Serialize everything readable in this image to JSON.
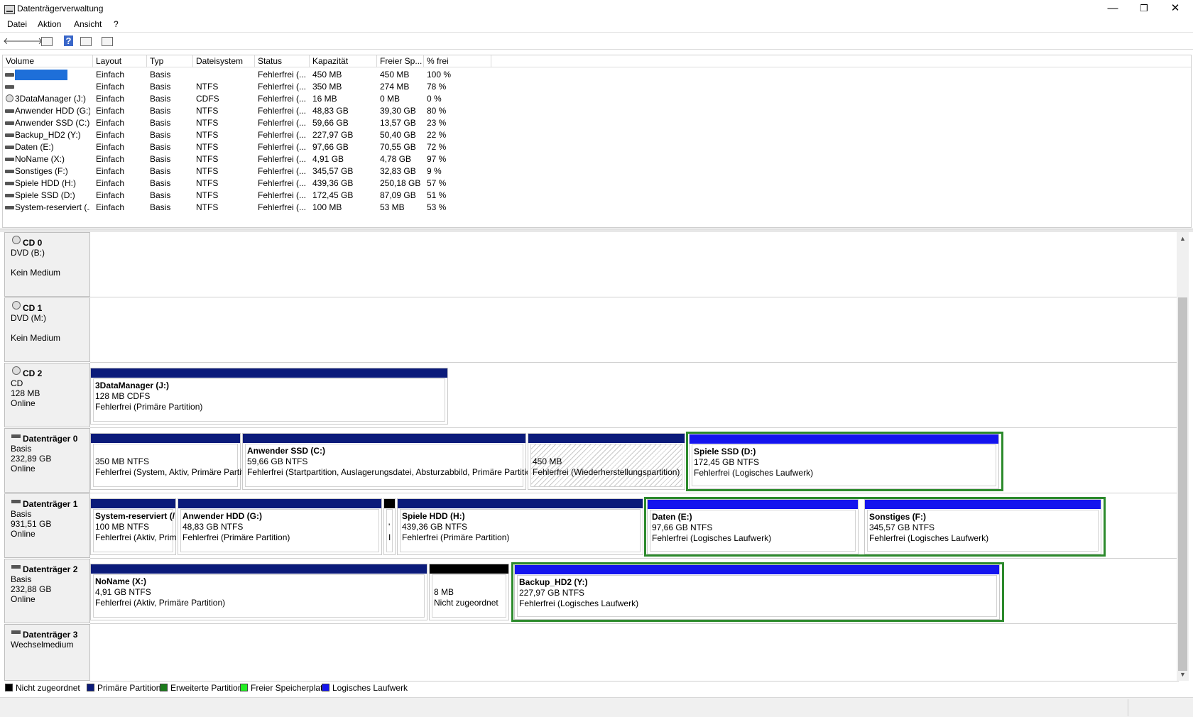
{
  "window": {
    "title": "Datenträgerverwaltung",
    "min": "—",
    "restore": "❐",
    "close": "✕"
  },
  "menu": [
    "Datei",
    "Aktion",
    "Ansicht",
    "?"
  ],
  "toolbar": {
    "back": "🡐",
    "forward": "🡒",
    "help": "?"
  },
  "volume_table": {
    "headers": [
      "Volume",
      "Layout",
      "Typ",
      "Dateisystem",
      "Status",
      "Kapazität",
      "Freier Sp...",
      "% frei"
    ],
    "rows": [
      {
        "volume": "",
        "layout": "Einfach",
        "typ": "Basis",
        "fs": "",
        "status": "Fehlerfrei (...",
        "cap": "450 MB",
        "free": "450 MB",
        "pct": "100 %",
        "icon": "drive-icon",
        "selected": true
      },
      {
        "volume": "",
        "layout": "Einfach",
        "typ": "Basis",
        "fs": "NTFS",
        "status": "Fehlerfrei (...",
        "cap": "350 MB",
        "free": "274 MB",
        "pct": "78 %",
        "icon": "drive-icon"
      },
      {
        "volume": "3DataManager (J:)",
        "layout": "Einfach",
        "typ": "Basis",
        "fs": "CDFS",
        "status": "Fehlerfrei (...",
        "cap": "16 MB",
        "free": "0 MB",
        "pct": "0 %",
        "icon": "cd-icon"
      },
      {
        "volume": "Anwender HDD (G:)",
        "layout": "Einfach",
        "typ": "Basis",
        "fs": "NTFS",
        "status": "Fehlerfrei (...",
        "cap": "48,83 GB",
        "free": "39,30 GB",
        "pct": "80 %",
        "icon": "drive-icon"
      },
      {
        "volume": "Anwender SSD (C:)",
        "layout": "Einfach",
        "typ": "Basis",
        "fs": "NTFS",
        "status": "Fehlerfrei (...",
        "cap": "59,66 GB",
        "free": "13,57 GB",
        "pct": "23 %",
        "icon": "drive-icon"
      },
      {
        "volume": "Backup_HD2 (Y:)",
        "layout": "Einfach",
        "typ": "Basis",
        "fs": "NTFS",
        "status": "Fehlerfrei (...",
        "cap": "227,97 GB",
        "free": "50,40 GB",
        "pct": "22 %",
        "icon": "drive-icon"
      },
      {
        "volume": "Daten (E:)",
        "layout": "Einfach",
        "typ": "Basis",
        "fs": "NTFS",
        "status": "Fehlerfrei (...",
        "cap": "97,66 GB",
        "free": "70,55 GB",
        "pct": "72 %",
        "icon": "drive-icon"
      },
      {
        "volume": "NoName (X:)",
        "layout": "Einfach",
        "typ": "Basis",
        "fs": "NTFS",
        "status": "Fehlerfrei (...",
        "cap": "4,91 GB",
        "free": "4,78 GB",
        "pct": "97 %",
        "icon": "drive-icon"
      },
      {
        "volume": "Sonstiges (F:)",
        "layout": "Einfach",
        "typ": "Basis",
        "fs": "NTFS",
        "status": "Fehlerfrei (...",
        "cap": "345,57 GB",
        "free": "32,83 GB",
        "pct": "9 %",
        "icon": "drive-icon"
      },
      {
        "volume": "Spiele HDD (H:)",
        "layout": "Einfach",
        "typ": "Basis",
        "fs": "NTFS",
        "status": "Fehlerfrei (...",
        "cap": "439,36 GB",
        "free": "250,18 GB",
        "pct": "57 %",
        "icon": "drive-icon"
      },
      {
        "volume": "Spiele SSD (D:)",
        "layout": "Einfach",
        "typ": "Basis",
        "fs": "NTFS",
        "status": "Fehlerfrei (...",
        "cap": "172,45 GB",
        "free": "87,09 GB",
        "pct": "51 %",
        "icon": "drive-icon"
      },
      {
        "volume": "System-reserviert (...",
        "layout": "Einfach",
        "typ": "Basis",
        "fs": "NTFS",
        "status": "Fehlerfrei (...",
        "cap": "100 MB",
        "free": "53 MB",
        "pct": "53 %",
        "icon": "drive-icon"
      }
    ]
  },
  "disks": [
    {
      "name": "CD 0",
      "lines": [
        "DVD (B:)",
        "",
        "Kein Medium"
      ],
      "icon": "cd-icon",
      "partitions": []
    },
    {
      "name": "CD 1",
      "lines": [
        "DVD (M:)",
        "",
        "Kein Medium"
      ],
      "icon": "cd-icon",
      "partitions": []
    },
    {
      "name": "CD 2",
      "lines": [
        "CD",
        "128 MB",
        "Online"
      ],
      "icon": "cd-icon",
      "partitions": [
        {
          "title": "3DataManager  (J:)",
          "size": "128 MB CDFS",
          "status": "Fehlerfrei (Primäre Partition)",
          "kind": "primary"
        }
      ]
    },
    {
      "name": "Datenträger 0",
      "lines": [
        "Basis",
        "232,89 GB",
        "Online"
      ],
      "icon": "drive-icon",
      "partitions": [
        {
          "title": "",
          "size": "350 MB NTFS",
          "status": "Fehlerfrei (System, Aktiv, Primäre Partitio",
          "kind": "primary"
        },
        {
          "title": "Anwender SSD  (C:)",
          "size": "59,66 GB NTFS",
          "status": "Fehlerfrei (Startpartition, Auslagerungsdatei, Absturzabbild, Primäre Partition)",
          "kind": "primary"
        },
        {
          "title": "",
          "size": "450 MB",
          "status": "Fehlerfrei (Wiederherstellungspartition)",
          "kind": "primary-hatched"
        },
        {
          "title": "Spiele SSD  (D:)",
          "size": "172,45 GB NTFS",
          "status": "Fehlerfrei (Logisches Laufwerk)",
          "kind": "logical"
        }
      ]
    },
    {
      "name": "Datenträger 1",
      "lines": [
        "Basis",
        "931,51 GB",
        "Online"
      ],
      "icon": "drive-icon",
      "partitions": [
        {
          "title": "System-reserviert  (/",
          "size": "100 MB NTFS",
          "status": "Fehlerfrei (Aktiv, Prim",
          "kind": "primary"
        },
        {
          "title": "Anwender HDD  (G:)",
          "size": "48,83 GB NTFS",
          "status": "Fehlerfrei (Primäre Partition)",
          "kind": "primary"
        },
        {
          "title": "",
          "size": "'",
          "status": "I",
          "kind": "unallocated"
        },
        {
          "title": "Spiele HDD  (H:)",
          "size": "439,36 GB NTFS",
          "status": "Fehlerfrei (Primäre Partition)",
          "kind": "primary"
        },
        {
          "title": "Daten  (E:)",
          "size": "97,66 GB NTFS",
          "status": "Fehlerfrei (Logisches Laufwerk)",
          "kind": "logical"
        },
        {
          "title": "Sonstiges  (F:)",
          "size": "345,57 GB NTFS",
          "status": "Fehlerfrei (Logisches Laufwerk)",
          "kind": "logical"
        }
      ]
    },
    {
      "name": "Datenträger 2",
      "lines": [
        "Basis",
        "232,88 GB",
        "Online"
      ],
      "icon": "drive-icon",
      "partitions": [
        {
          "title": "NoName  (X:)",
          "size": "4,91 GB NTFS",
          "status": "Fehlerfrei (Aktiv, Primäre Partition)",
          "kind": "primary"
        },
        {
          "title": "",
          "size": "8 MB",
          "status": "Nicht zugeordnet",
          "kind": "unallocated"
        },
        {
          "title": "Backup_HD2  (Y:)",
          "size": "227,97 GB NTFS",
          "status": "Fehlerfrei (Logisches Laufwerk)",
          "kind": "logical"
        }
      ]
    },
    {
      "name": "Datenträger 3",
      "lines": [
        "Wechselmedium"
      ],
      "icon": "drive-icon",
      "partitions": []
    }
  ],
  "legend": [
    {
      "label": "Nicht zugeordnet",
      "color": "#000000"
    },
    {
      "label": "Primäre Partition",
      "color": "#0b1b7a"
    },
    {
      "label": "Erweiterte Partition",
      "color": "#1a7a1a"
    },
    {
      "label": "Freier Speicherplatz",
      "color": "#22ee22"
    },
    {
      "label": "Logisches Laufwerk",
      "color": "#1414ee"
    }
  ],
  "colors": {
    "primary": "#0b1b7a",
    "logical": "#1414ee",
    "unallocated": "#000000",
    "extended": "#2c8a2c"
  }
}
